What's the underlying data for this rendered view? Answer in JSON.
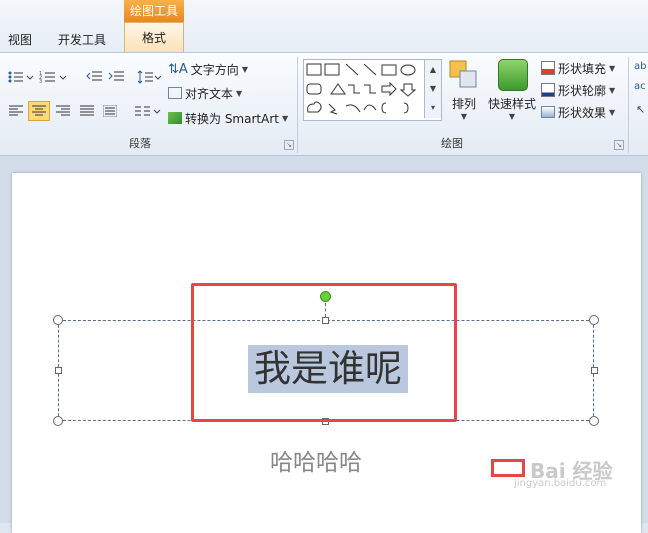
{
  "tabs": {
    "view": "视图",
    "developer": "开发工具",
    "context_group": "绘图工具",
    "format": "格式"
  },
  "ribbon": {
    "paragraph": {
      "label": "段落",
      "text_direction": "文字方向",
      "align_text": "对齐文本",
      "convert_smartart": "转换为 SmartArt"
    },
    "drawing": {
      "label": "绘图",
      "arrange": "排列",
      "quick_styles": "快速样式",
      "shape_fill": "形状填充",
      "shape_outline": "形状轮廓",
      "shape_effects": "形状效果"
    }
  },
  "slide": {
    "title_text": "我是谁呢",
    "subtitle_text": "哈哈哈哈"
  },
  "watermark": {
    "text": "Bai 经验",
    "url": "jingyan.baidu.com"
  },
  "colors": {
    "selection_highlight": "#b9c8df",
    "annotation_red": "#e84545",
    "context_tab": "#f0a03a",
    "rotation_handle": "#6bcf3a"
  }
}
